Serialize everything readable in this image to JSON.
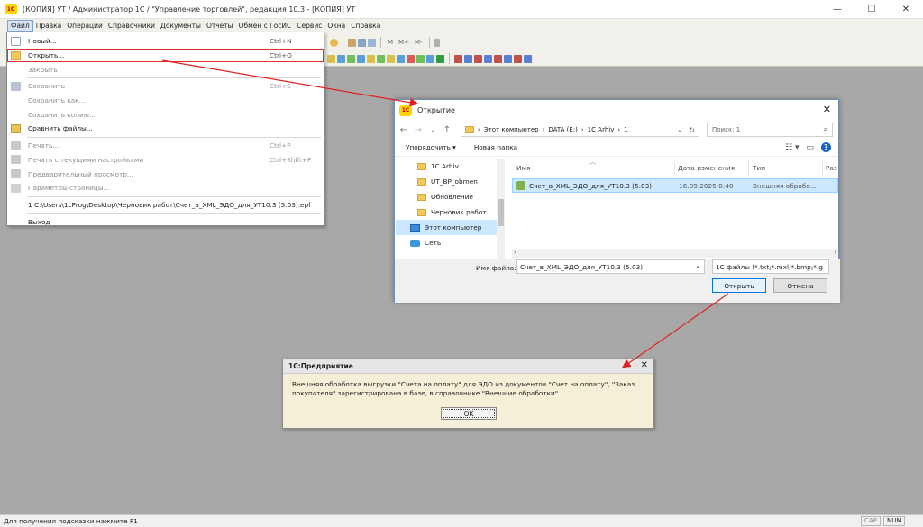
{
  "window": {
    "logo": "1С",
    "title": "[КОПИЯ] УТ / Администратор 1С / \"Управление торговлей\", редакция 10.3 - [КОПИЯ] УТ",
    "minimize": "—",
    "maximize": "☐",
    "close": "✕"
  },
  "menubar": {
    "items": [
      "Файл",
      "Правка",
      "Операции",
      "Справочники",
      "Документы",
      "Отчеты",
      "Обмен с ГосИС",
      "Сервис",
      "Окна",
      "Справка"
    ]
  },
  "toolbar": {
    "labels": [
      "M",
      "M+",
      "M-"
    ]
  },
  "file_menu": {
    "items": [
      {
        "label": "Новый...",
        "shortcut": "Ctrl+N",
        "icon": "new-document-icon",
        "disabled": false
      },
      {
        "label": "Открыть...",
        "shortcut": "Ctrl+O",
        "icon": "open-folder-icon",
        "disabled": false
      },
      {
        "label": "Закрыть",
        "shortcut": "",
        "icon": "",
        "disabled": true
      },
      {
        "label": "Сохранить",
        "shortcut": "Ctrl+S",
        "icon": "save-icon",
        "disabled": true
      },
      {
        "label": "Сохранить как...",
        "shortcut": "",
        "icon": "",
        "disabled": true
      },
      {
        "label": "Сохранить копию...",
        "shortcut": "",
        "icon": "",
        "disabled": true
      },
      {
        "label": "Сравнить файлы...",
        "shortcut": "",
        "icon": "compare-icon",
        "disabled": false
      },
      {
        "label": "Печать...",
        "shortcut": "Ctrl+P",
        "icon": "print-icon",
        "disabled": true
      },
      {
        "label": "Печать с текущими настройками",
        "shortcut": "Ctrl+Shift+P",
        "icon": "quick-print-icon",
        "disabled": true
      },
      {
        "label": "Предварительный просмотр...",
        "shortcut": "",
        "icon": "preview-icon",
        "disabled": true
      },
      {
        "label": "Параметры страницы...",
        "shortcut": "",
        "icon": "page-setup-icon",
        "disabled": true
      },
      {
        "label": "1 C:\\Users\\1cProg\\Desktop\\Черновик работ\\Счет_в_XML_ЭДО_для_УТ10.3 (5.03).epf",
        "shortcut": "",
        "icon": "",
        "disabled": false
      },
      {
        "label": "Выход",
        "shortcut": "",
        "icon": "",
        "disabled": false
      }
    ]
  },
  "open_dialog": {
    "title": "Открытие",
    "breadcrumbs": [
      "›",
      "Этот компьютер",
      "›",
      "DATA (E:)",
      "›",
      "1C Arhiv",
      "›",
      "1"
    ],
    "search_placeholder": "Поиск: 1",
    "organize_label": "Упорядочить ▾",
    "new_folder_label": "Новая папка",
    "nav_items": [
      {
        "label": "1C Arhiv",
        "type": "folder"
      },
      {
        "label": "UT_BP_obmen",
        "type": "folder"
      },
      {
        "label": "Обновление",
        "type": "folder"
      },
      {
        "label": "Черновик работ",
        "type": "folder"
      },
      {
        "label": "Этот компьютер",
        "type": "pc"
      },
      {
        "label": "Сеть",
        "type": "network"
      }
    ],
    "columns": [
      "Имя",
      "Дата изменения",
      "Тип",
      "Раз"
    ],
    "files": [
      {
        "name": "Счет_в_XML_ЭДО_для_УТ10.3 (5.03)",
        "date": "16.09.2025 0:40",
        "type": "Внешняя обрабо..."
      }
    ],
    "filename_label": "Имя файла:",
    "filename_value": "Счет_в_XML_ЭДО_для_УТ10.3 (5.03)",
    "filetype_value": "1С файлы (*.txt;*.mxl;*.bmp;*.g",
    "open_button": "Открыть",
    "cancel_button": "Отмена"
  },
  "message_box": {
    "title": "1С:Предприятие",
    "text": "Внешняя обработка выгрузки \"Счета на оплату\" для ЭДО из документов \"Счет на оплату\", \"Заказ покупателя\" зарегистрирована в базе, в справочнике \"Внешние обработки\"",
    "ok_button": "OK"
  },
  "statusbar": {
    "hint": "Для получения подсказки нажмите F1",
    "cap": "CAP",
    "num": "NUM"
  },
  "colors": {
    "menu_highlight": "#d8e4f4",
    "annotation_red": "#e02020",
    "message_bg": "#f6efd8",
    "selection": "#cce8ff"
  }
}
